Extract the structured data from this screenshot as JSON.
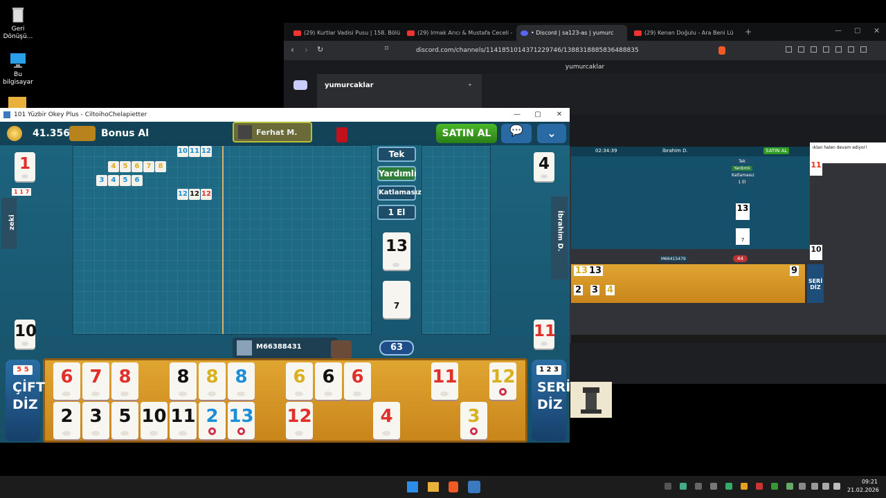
{
  "desktop": {
    "icons": [
      {
        "label": "Geri Dönüşü...",
        "icon": "recycle-bin-icon"
      },
      {
        "label": "Bu bilgisayar",
        "icon": "computer-icon"
      }
    ]
  },
  "browser": {
    "tabs": [
      {
        "label": "(29) Kurtlar Vadisi Pusu | 158. Bölüm |",
        "active": false
      },
      {
        "label": "(29) Irmak Arıcı & Mustafa Ceceli - M",
        "active": false
      },
      {
        "label": "• Discord | sa123-as | yumurc",
        "active": true
      },
      {
        "label": "(29) Kenan Doğulu - Ara Beni Lü",
        "active": false
      }
    ],
    "url": "discord.com/channels/1141851014371229746/1388318885836488835",
    "page_title": "yumurcaklar",
    "server_name": "yumurcaklar"
  },
  "stream": {
    "player_top": "İbrahim D.",
    "timer": "02:34:39",
    "buy": "SATIN AL",
    "mode_labels": [
      "Tek",
      "Yardımlı",
      "Katlamasız",
      "1 El"
    ],
    "center_tile": "13",
    "indicator": "7",
    "left_count": "11",
    "bottom_count": "10",
    "player_bottom": "M66415479",
    "pool": "44",
    "rack_top": [
      "13",
      "13",
      "9"
    ],
    "rack_bottom": [
      "2",
      "3",
      "4"
    ],
    "seri": "SERİ DİZ",
    "notice": "ıklan halen devam ediyor!"
  },
  "game": {
    "window_title": "101 Yüzbir Okey Plus - CiltoihoChelapietter",
    "coins": "41.356",
    "bonus": "Bonus Al",
    "top_player": "Ferhat M.",
    "buy_button": "SATIN AL",
    "left_player": "zeki",
    "right_player": "İbrahim D.",
    "bottom_player": "M66388431",
    "pool_count": "63",
    "mode_labels": [
      "Tek",
      "Yardımlı",
      "Katlamasız",
      "1 El"
    ],
    "center_tile": "13",
    "indicator_tile": "7",
    "corner_top_left": "1",
    "corner_top_right": "4",
    "corner_bottom_left": "10",
    "corner_bottom_right": "11",
    "discard_left": "1 1 7",
    "board_groups": [
      {
        "tiles": [
          "10",
          "11",
          "12"
        ],
        "color": "blue"
      },
      {
        "tiles": [
          "4",
          "5",
          "6",
          "7",
          "8"
        ],
        "color": "yellow"
      },
      {
        "tiles": [
          "3",
          "4",
          "5",
          "6"
        ],
        "color": "blue"
      },
      {
        "tiles": [
          "12",
          "12",
          "12"
        ],
        "color": "mixed"
      }
    ],
    "rack_top": [
      {
        "n": "6",
        "c": "red"
      },
      {
        "n": "7",
        "c": "red"
      },
      {
        "n": "8",
        "c": "red"
      },
      {
        "n": "8",
        "c": "black"
      },
      {
        "n": "8",
        "c": "yellow"
      },
      {
        "n": "8",
        "c": "blue"
      },
      {
        "n": "6",
        "c": "yellow"
      },
      {
        "n": "6",
        "c": "black"
      },
      {
        "n": "6",
        "c": "red"
      },
      {
        "n": "11",
        "c": "red"
      },
      {
        "n": "12",
        "c": "yellow"
      }
    ],
    "rack_bottom": [
      {
        "n": "2",
        "c": "black"
      },
      {
        "n": "3",
        "c": "black"
      },
      {
        "n": "5",
        "c": "black"
      },
      {
        "n": "10",
        "c": "black"
      },
      {
        "n": "11",
        "c": "black"
      },
      {
        "n": "2",
        "c": "blue"
      },
      {
        "n": "13",
        "c": "blue"
      },
      {
        "n": "12",
        "c": "red"
      },
      {
        "n": "4",
        "c": "red"
      },
      {
        "n": "3",
        "c": "yellow"
      }
    ],
    "cift_badge": "5 5",
    "cift_label": "ÇİFT DİZ",
    "seri_badge": "1 2 3",
    "seri_label": "SERİ DİZ"
  },
  "taskbar": {
    "time": "09:21",
    "date": "21.02.2026"
  }
}
